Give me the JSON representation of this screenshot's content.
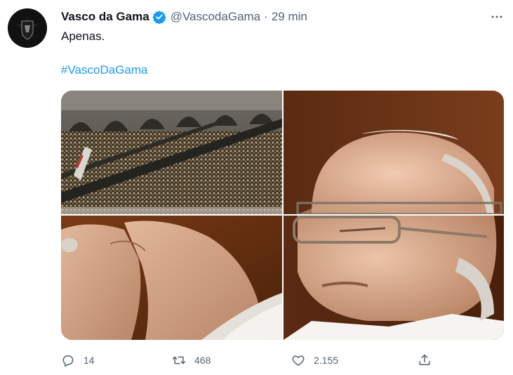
{
  "account": {
    "name": "Vasco da Gama",
    "handle": "@VascodaGama",
    "separator": "·",
    "time": "29 min",
    "verified": true
  },
  "tweet": {
    "text": "Apenas.",
    "hashtag": "#VascoDaGama"
  },
  "media": {
    "images": [
      {
        "description": "stadium crowd"
      },
      {
        "description": "man with glasses, upper"
      },
      {
        "description": "hands clasped"
      },
      {
        "description": "man with glasses, eyes closed"
      }
    ]
  },
  "actions": {
    "replies": "14",
    "retweets": "468",
    "likes": "2.155"
  },
  "colors": {
    "accent": "#1d9bf0",
    "text_primary": "#0f1419",
    "text_secondary": "#536471"
  }
}
